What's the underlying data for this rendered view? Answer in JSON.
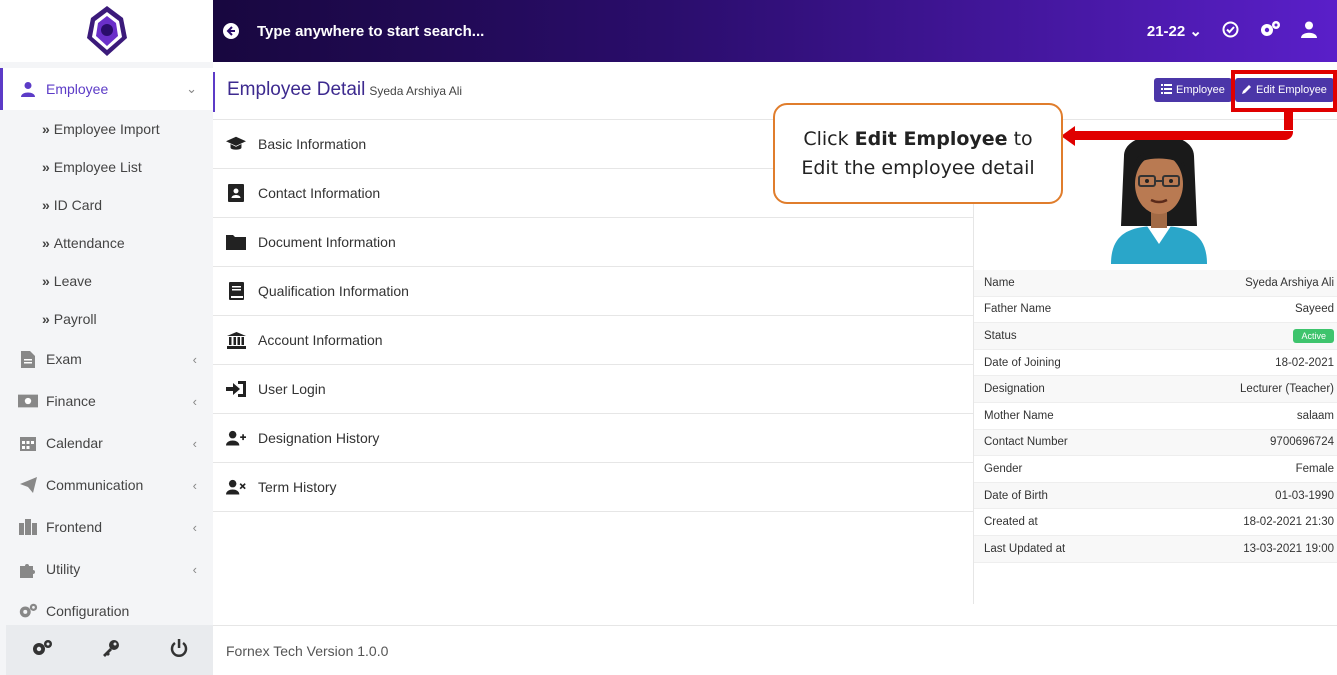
{
  "topbar": {
    "search_placeholder": "Type anywhere to start search...",
    "session": "21-22"
  },
  "sidebar": {
    "items": [
      {
        "label": "Employee",
        "icon": "user-icon",
        "active": true
      },
      {
        "label": "Exam",
        "icon": "document-icon"
      },
      {
        "label": "Finance",
        "icon": "money-icon"
      },
      {
        "label": "Calendar",
        "icon": "calendar-icon"
      },
      {
        "label": "Communication",
        "icon": "paper-plane-icon"
      },
      {
        "label": "Frontend",
        "icon": "building-icon"
      },
      {
        "label": "Utility",
        "icon": "puzzle-icon"
      },
      {
        "label": "Configuration",
        "icon": "gears-icon"
      }
    ],
    "employee_subitems": [
      "Employee Import",
      "Employee List",
      "ID Card",
      "Attendance",
      "Leave",
      "Payroll"
    ],
    "footer_icons": [
      "gears-icon",
      "key-icon",
      "power-icon"
    ]
  },
  "header": {
    "title": "Employee Detail",
    "subtitle": "Syeda Arshiya Ali",
    "employee_button": "Employee",
    "edit_button": "Edit Employee"
  },
  "callout": {
    "prefix": "Click ",
    "bold": "Edit Employee",
    "suffix": " to",
    "line2": "Edit the employee detail"
  },
  "sections": [
    {
      "label": "Basic Information",
      "icon": "graduation-cap-icon"
    },
    {
      "label": "Contact Information",
      "icon": "address-book-icon"
    },
    {
      "label": "Document Information",
      "icon": "folder-icon"
    },
    {
      "label": "Qualification Information",
      "icon": "book-icon"
    },
    {
      "label": "Account Information",
      "icon": "bank-icon"
    },
    {
      "label": "User Login",
      "icon": "sign-in-icon"
    },
    {
      "label": "Designation History",
      "icon": "user-plus-icon"
    },
    {
      "label": "Term History",
      "icon": "user-times-icon"
    }
  ],
  "details": [
    {
      "label": "Name",
      "value": "Syeda Arshiya Ali"
    },
    {
      "label": "Father Name",
      "value": "Sayeed"
    },
    {
      "label": "Status",
      "value": "Active"
    },
    {
      "label": "Date of Joining",
      "value": "18-02-2021"
    },
    {
      "label": "Designation",
      "value": "Lecturer (Teacher)"
    },
    {
      "label": "Mother Name",
      "value": "salaam"
    },
    {
      "label": "Contact Number",
      "value": "9700696724"
    },
    {
      "label": "Gender",
      "value": "Female"
    },
    {
      "label": "Date of Birth",
      "value": "01-03-1990"
    },
    {
      "label": "Created at",
      "value": "18-02-2021 21:30"
    },
    {
      "label": "Last Updated at",
      "value": "13-03-2021 19:00"
    }
  ],
  "footer": {
    "text": "Fornex Tech Version 1.0.0"
  },
  "colors": {
    "accent": "#4b36a8",
    "highlight": "#e00000",
    "callout_border": "#e07d2c",
    "active_badge": "#3ec46d"
  }
}
